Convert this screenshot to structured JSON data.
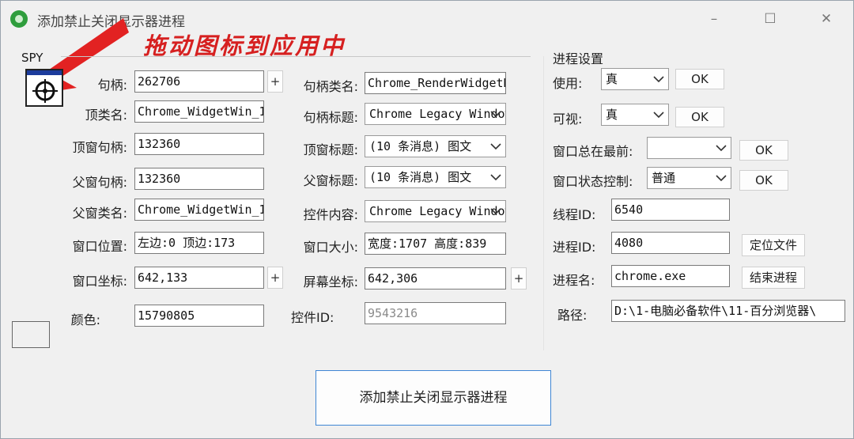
{
  "window": {
    "title": "添加禁止关闭显示器进程",
    "controls": {
      "minimize": "–",
      "maximize": "☐",
      "close": "✕"
    }
  },
  "hint": "拖动图标到应用中",
  "spy": {
    "label": "SPY"
  },
  "fields": {
    "handle": {
      "label": "句柄:",
      "value": "262706"
    },
    "top_class": {
      "label": "顶类名:",
      "value": "Chrome_WidgetWin_1"
    },
    "top_handle": {
      "label": "顶窗句柄:",
      "value": "132360"
    },
    "parent_handle": {
      "label": "父窗句柄:",
      "value": "132360"
    },
    "parent_class": {
      "label": "父窗类名:",
      "value": "Chrome_WidgetWin_1"
    },
    "window_pos": {
      "label": "窗口位置:",
      "value": "左边:0 顶边:173"
    },
    "window_coord": {
      "label": "窗口坐标:",
      "value": "642,133"
    },
    "color": {
      "label": "颜色:",
      "value": "15790805"
    },
    "handle_class": {
      "label": "句柄类名:",
      "value": "Chrome_RenderWidgetHostHWND"
    },
    "handle_title": {
      "label": "句柄标题:",
      "value": "Chrome Legacy Window"
    },
    "top_title": {
      "label": "顶窗标题:",
      "value": "(10 条消息) 图文"
    },
    "parent_title": {
      "label": "父窗标题:",
      "value": "(10 条消息) 图文"
    },
    "control_content": {
      "label": "控件内容:",
      "value": "Chrome Legacy Window"
    },
    "window_size": {
      "label": "窗口大小:",
      "value": "宽度:1707 高度:839"
    },
    "screen_coord": {
      "label": "屏幕坐标:",
      "value": "642,306"
    },
    "control_id": {
      "label": "控件ID:",
      "value": "9543216"
    }
  },
  "plus_label": "+",
  "process_settings": {
    "title": "进程设置",
    "ok_label": "OK",
    "use": {
      "label": "使用:",
      "value": "真"
    },
    "visible": {
      "label": "可视:",
      "value": "真"
    },
    "topmost": {
      "label": "窗口总在最前:",
      "value": ""
    },
    "state": {
      "label": "窗口状态控制:",
      "value": "普通"
    },
    "thread_id": {
      "label": "线程ID:",
      "value": "6540"
    },
    "process_id": {
      "label": "进程ID:",
      "value": "4080"
    },
    "process_name": {
      "label": "进程名:",
      "value": "chrome.exe"
    },
    "path": {
      "label": "路径:",
      "value": "D:\\1-电脑必备软件\\11-百分浏览器\\"
    },
    "locate_button": "定位文件",
    "end_button": "结束进程"
  },
  "main_button": "添加禁止关闭显示器进程",
  "colors": {
    "accent": "#3f86d4",
    "hint": "#d62020",
    "app_icon": "#2e9d3c"
  }
}
